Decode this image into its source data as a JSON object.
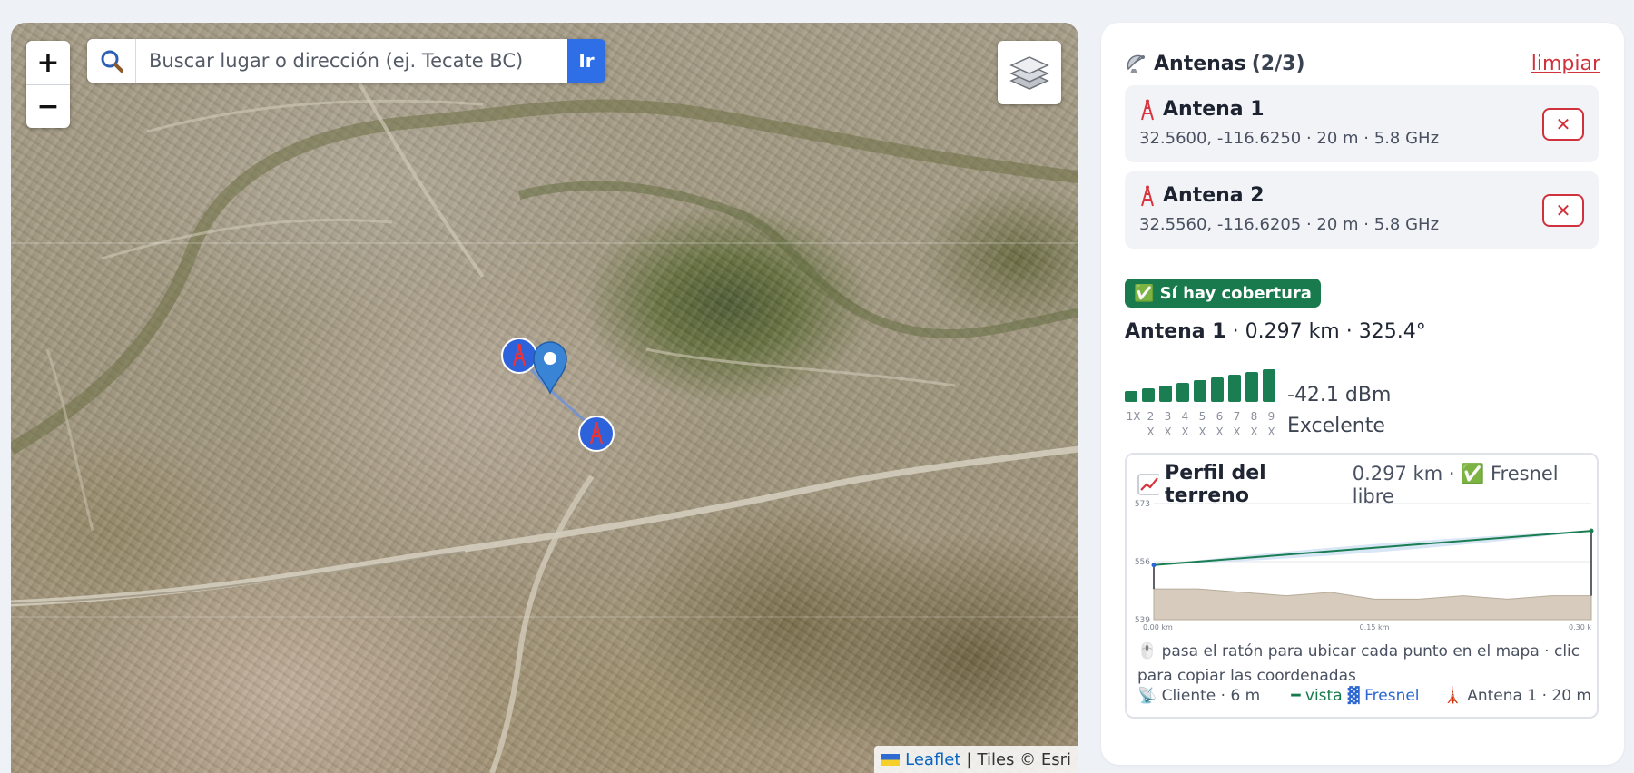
{
  "map": {
    "zoom_in": "+",
    "zoom_out": "−",
    "search_placeholder": "Buscar lugar o dirección (ej. Tecate BC)",
    "search_button": "Ir",
    "attribution_leaflet": "Leaflet",
    "attribution_sep": "|",
    "attribution_tiles": "Tiles © Esri"
  },
  "panel": {
    "title_label": "Antenas",
    "title_count": "(2/3)",
    "clear_label": "limpiar",
    "antennas": [
      {
        "name": "Antena 1",
        "info": "32.5600, -116.6250 · 20 m · 5.8 GHz",
        "delete": "✕"
      },
      {
        "name": "Antena 2",
        "info": "32.5560, -116.6205 · 20 m · 5.8 GHz",
        "delete": "✕"
      }
    ],
    "coverage_badge": "✅ Sí hay cobertura",
    "best_link": {
      "name": "Antena 1",
      "details": " · 0.297 km · 325.4°"
    },
    "signal": {
      "bars_active": 9,
      "bar_labels_top": [
        "1X",
        "2",
        "3",
        "4",
        "5",
        "6",
        "7",
        "8",
        "9"
      ],
      "bar_labels_bottom": [
        "",
        "X",
        "X",
        "X",
        "X",
        "X",
        "X",
        "X",
        "X"
      ],
      "dbm": "-42.1 dBm",
      "quality": "Excelente"
    },
    "profile": {
      "title": "Perfil del terreno",
      "meta": "0.297 km · ✅ Fresnel libre",
      "hint": "🖱️ pasa el ratón para ubicar cada punto en el mapa · clic para copiar las coordenadas",
      "legend_client": "📡 Cliente · 6 m",
      "legend_vista": "━ vista",
      "legend_fresnel": "▓ Fresnel",
      "legend_antenna": "🗼 Antena 1 · 20 m"
    }
  },
  "chart_data": {
    "type": "area",
    "title": "Perfil del terreno",
    "y_ticks": [
      "573",
      "556",
      "539"
    ],
    "x_ticks": [
      "0.00 km",
      "0.15 km",
      "0.30 k"
    ],
    "ylim": [
      539,
      573
    ],
    "xlim_km": [
      0,
      0.297
    ],
    "series": [
      {
        "name": "terreno",
        "x": [
          0,
          0.03,
          0.06,
          0.09,
          0.12,
          0.15,
          0.18,
          0.21,
          0.24,
          0.27,
          0.297
        ],
        "values": [
          548,
          548,
          547,
          546,
          547,
          545,
          545,
          546,
          545,
          546,
          546
        ]
      },
      {
        "name": "vista",
        "x": [
          0,
          0.297
        ],
        "values": [
          555,
          565
        ]
      }
    ],
    "colors": {
      "terrain": "#d6cbbd",
      "los": "#1a7e52",
      "fresnel": "#cfe0f3"
    }
  }
}
